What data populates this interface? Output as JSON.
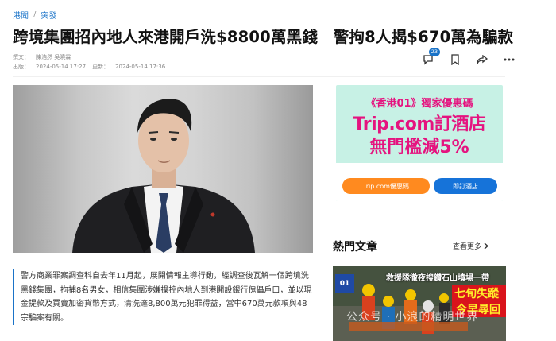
{
  "breadcrumb": {
    "section": "港聞",
    "subsection": "突發"
  },
  "article": {
    "title": "跨境集團招內地人來港開戶洗$8800萬黑錢　警拘8人揭$670萬為騙款",
    "byline_label": "撰文：",
    "byline": "陳浩然 吳曉霖",
    "published_label": "出版：",
    "published": "2024-05-14 17:27",
    "updated_label": "更新：",
    "updated": "2024-05-14 17:36",
    "comment_count": "23",
    "lead": "警方商業罪案調查科自去年11月起，展開情報主導行動，經調查後瓦解一個跨境洗黑錢集團，拘捕8名男女，相信集團涉嫌操控內地人到港開設銀行傀儡戶口，並以現金提款及買賣加密貨幣方式，清洗達8,800萬元犯罪得益，當中670萬元款項與48宗騙案有關。"
  },
  "ad": {
    "line1": "《香港01》獨家優惠碼",
    "line2": "Trip.com訂酒店",
    "line3": "無門檻減5%",
    "btn_code": "Trip.com優惠碼",
    "btn_hotel": "即訂酒店"
  },
  "hot": {
    "title": "熱門文章",
    "more": "查看更多",
    "thumb_logo": "01",
    "thumb_caption": "救援隊徹夜搜鑽石山墳場一帶",
    "thumb_red1": "七旬失蹤婦",
    "thumb_red2": "今早尋回"
  },
  "watermark": "公众号 · 小浪的精明世界",
  "colors": {
    "accent": "#1a73c8",
    "ad_pink": "#e5137f",
    "ad_bg": "#c7f1e5",
    "orange": "#ff8a1f"
  }
}
